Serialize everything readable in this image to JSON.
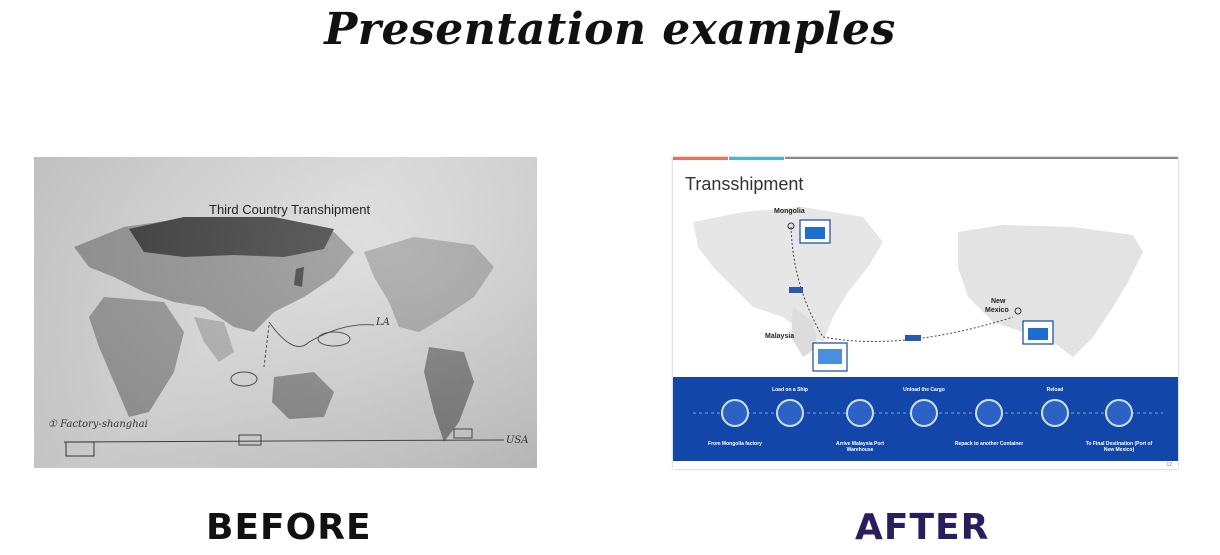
{
  "header": {
    "title": "Presentation examples"
  },
  "before": {
    "caption": "BEFORE",
    "map_title": "Third Country Transhipment",
    "annotations": {
      "la": "LA",
      "factory": "① Factory-shanghai",
      "usa": "USA"
    }
  },
  "after": {
    "caption": "AFTER",
    "slide_title": "Transshipment",
    "places": {
      "mongolia": "Mongolia",
      "malaysia": "Malaysia",
      "new_mexico_1": "New",
      "new_mexico_2": "Mexico"
    },
    "steps_top": [
      "Load on a Ship",
      "Unload the Cargo",
      "Reload"
    ],
    "steps_bottom": [
      "From Mongolia factory",
      "Arrive Malaysia Port Warehouse",
      "Repack to another Container",
      "To Final Destination (Port of New Mexico)"
    ],
    "slide_number": "12"
  },
  "colors": {
    "band": "#1246a8",
    "after_caption": "#2a1f5c",
    "slide_top_bar_1": "#e8715a",
    "slide_top_bar_2": "#4bb6c9",
    "slide_top_bar_3": "#888888"
  }
}
